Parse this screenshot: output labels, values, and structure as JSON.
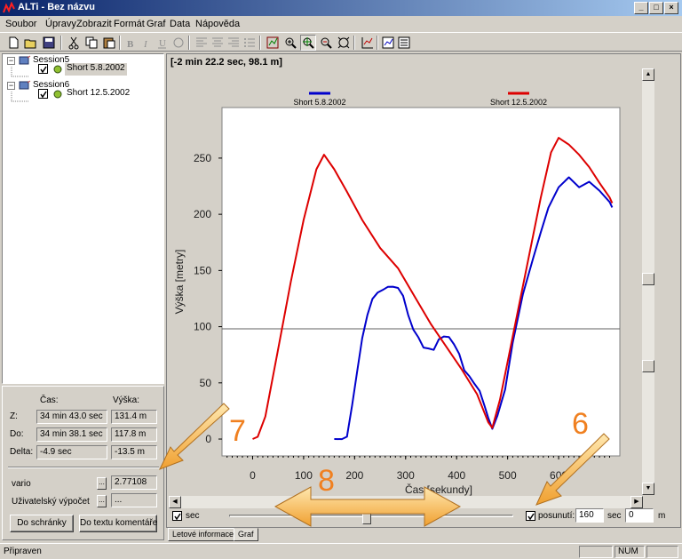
{
  "window": {
    "title": "ALTi - Bez názvu"
  },
  "menu": [
    "Soubor",
    "Úpravy",
    "Zobrazit",
    "Formát",
    "Graf",
    "Data",
    "Nápověda"
  ],
  "tree": {
    "sessions": [
      {
        "name": "Session5",
        "item": "Short 5.8.2002",
        "selected": true
      },
      {
        "name": "Session6",
        "item": "Short 12.5.2002",
        "selected": false
      }
    ]
  },
  "info": {
    "header_time": "Čas:",
    "header_alt": "Výška:",
    "rows": [
      {
        "label": "Z:",
        "time": "34 min 43.0 sec",
        "alt": "131.4 m"
      },
      {
        "label": "Do:",
        "time": "34 min 38.1 sec",
        "alt": "117.8 m"
      },
      {
        "label": "Delta:",
        "time": "-4.9 sec",
        "alt": "-13.5 m"
      }
    ],
    "vario_label": "vario",
    "vario_value": "2.77108",
    "user_calc_label": "Uživatelský výpočet",
    "user_calc_value": "...",
    "copy_button": "Do schránky",
    "comment_button": "Do textu komentáře"
  },
  "graph": {
    "cursor_readout": "[-2 min 22.2 sec, 98.1 m]",
    "sec_label": "sec",
    "offset_label": "posunutí:",
    "offset_value": "160",
    "offset_unit_sec": "sec",
    "offset_m_value": "0",
    "offset_unit_m": "m"
  },
  "chart_data": {
    "type": "line",
    "xlabel": "Čas [sekundy]",
    "ylabel": "Výška [metry]",
    "xlim": [
      -60,
      720
    ],
    "ylim": [
      -15,
      295
    ],
    "xticks": [
      0,
      100,
      200,
      300,
      400,
      500,
      600
    ],
    "xtick_labels": [
      "0",
      "100",
      "200",
      "300",
      "400",
      "500",
      "600"
    ],
    "yticks": [
      0,
      50,
      100,
      150,
      200,
      250
    ],
    "cursor_line_y": 98.1,
    "series": [
      {
        "name": "Short 5.8.2002",
        "color": "#0000cc",
        "x": [
          160,
          175,
          185,
          195,
          205,
          215,
          225,
          235,
          245,
          255,
          265,
          275,
          285,
          295,
          305,
          315,
          325,
          335,
          345,
          355,
          365,
          375,
          385,
          395,
          405,
          415,
          425,
          435,
          445,
          455,
          462,
          470,
          480,
          495,
          510,
          530,
          550,
          565,
          580,
          600,
          620,
          640,
          660,
          680,
          700,
          705
        ],
        "y": [
          0,
          0,
          2,
          30,
          60,
          90,
          110,
          125,
          130,
          133,
          135,
          136,
          134,
          128,
          110,
          98,
          90,
          82,
          80,
          80,
          88,
          92,
          90,
          85,
          75,
          62,
          55,
          50,
          42,
          30,
          18,
          10,
          20,
          45,
          85,
          130,
          160,
          185,
          205,
          225,
          232,
          225,
          228,
          222,
          210,
          207
        ]
      },
      {
        "name": "Short 12.5.2002",
        "color": "#dd0000",
        "x": [
          0,
          10,
          25,
          50,
          75,
          100,
          125,
          140,
          160,
          185,
          215,
          250,
          285,
          320,
          350,
          380,
          410,
          440,
          462,
          470,
          485,
          505,
          525,
          545,
          565,
          585,
          600,
          620,
          640,
          660,
          680,
          700,
          705
        ],
        "y": [
          0,
          2,
          20,
          80,
          140,
          195,
          240,
          253,
          240,
          220,
          195,
          170,
          152,
          125,
          102,
          82,
          62,
          40,
          15,
          10,
          35,
          80,
          125,
          170,
          215,
          255,
          268,
          262,
          253,
          242,
          228,
          215,
          210
        ]
      }
    ]
  }
}
